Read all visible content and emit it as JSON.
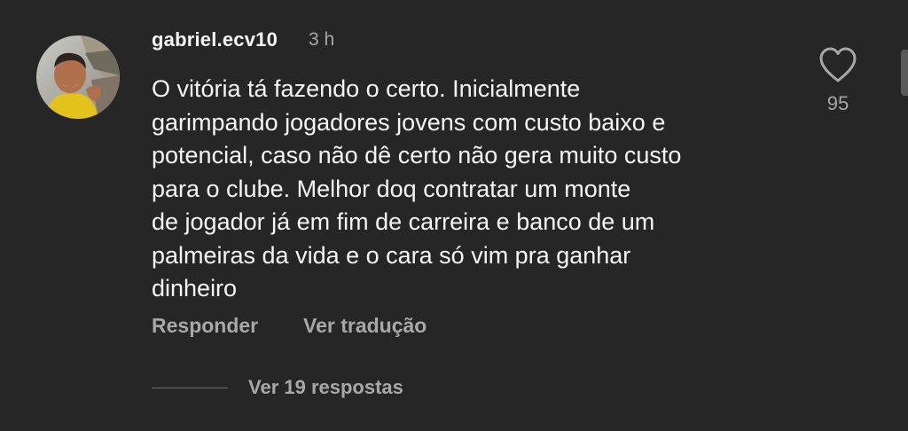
{
  "comment": {
    "username": "gabriel.ecv10",
    "timestamp": "3 h",
    "text_lines": [
      "O vitória tá fazendo o certo. Inicialmente",
      "garimpando jogadores jovens com custo baixo e",
      "potencial, caso não dê certo não gera muito custo",
      "para o clube. Melhor doq contratar um monte",
      "de jogador já em fim de carreira e banco de um",
      "palmeiras da vida e o cara só vim pra ganhar",
      "dinheiro"
    ],
    "like_count": "95",
    "actions": {
      "reply_label": "Responder",
      "translate_label": "Ver tradução"
    },
    "view_replies_label": "Ver 19 respostas"
  },
  "icons": {
    "like": "heart-outline-icon",
    "avatar": "user-avatar-photo"
  },
  "colors": {
    "background": "#262626",
    "primary_text": "#f5f5f5",
    "secondary_text": "#a8a8a8"
  }
}
